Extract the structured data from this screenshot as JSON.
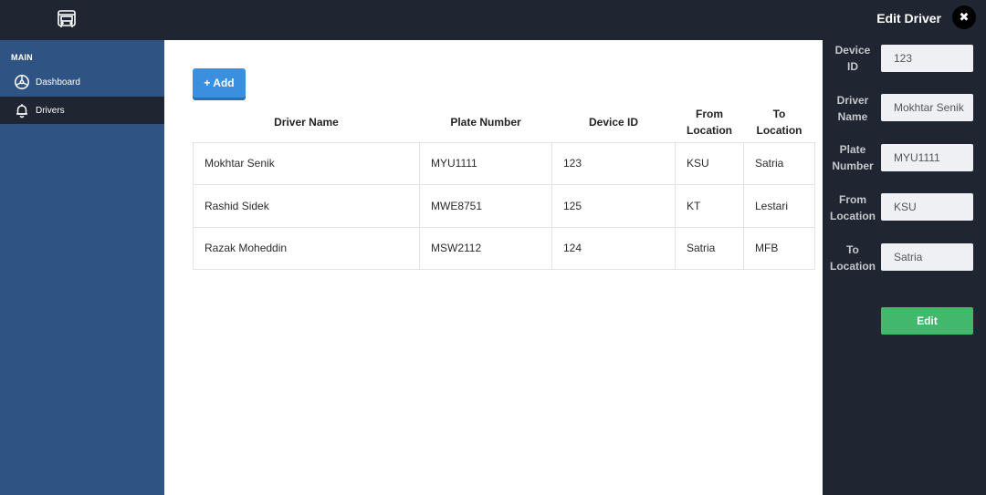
{
  "sidebar": {
    "section": "MAIN",
    "items": [
      {
        "label": "Dashboard",
        "icon": "dashboard-icon"
      },
      {
        "label": "Drivers",
        "icon": "bell-icon",
        "active": true
      }
    ]
  },
  "main": {
    "add_label": "+ Add",
    "columns": [
      "Driver Name",
      "Plate Number",
      "Device ID",
      "From Location",
      "To Location"
    ],
    "rows": [
      [
        "Mokhtar Senik",
        "MYU1111",
        "123",
        "KSU",
        "Satria"
      ],
      [
        "Rashid Sidek",
        "MWE8751",
        "125",
        "KT",
        "Lestari"
      ],
      [
        "Razak Moheddin",
        "MSW2112",
        "124",
        "Satria",
        "MFB"
      ]
    ]
  },
  "panel": {
    "title": "Edit Driver",
    "close_icon": "close-icon",
    "fields": [
      {
        "label": "Device ID",
        "value": "123"
      },
      {
        "label": "Driver Name",
        "value": "Mokhtar Senik"
      },
      {
        "label": "Plate Number",
        "value": "MYU1111"
      },
      {
        "label": "From Location",
        "value": "KSU"
      },
      {
        "label": "To Location",
        "value": "Satria"
      }
    ],
    "edit_label": "Edit"
  },
  "colors": {
    "topbar": "#1f2631",
    "sidebar": "#2f5484",
    "add_button": "#3a8fde",
    "edit_button": "#41b86c"
  }
}
